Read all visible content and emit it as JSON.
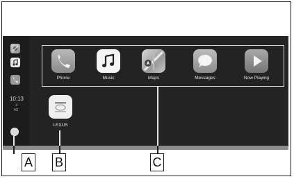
{
  "sidebar": {
    "time": "10:13",
    "signal": ".ıl",
    "network": "4G",
    "icons": [
      "maps-icon",
      "music-icon",
      "phone-icon"
    ]
  },
  "apps": [
    {
      "label": "Phone",
      "icon": "phone-icon"
    },
    {
      "label": "Music",
      "icon": "music-icon"
    },
    {
      "label": "Maps",
      "icon": "maps-icon"
    },
    {
      "label": "Messages",
      "icon": "messages-icon"
    },
    {
      "label": "Now Playing",
      "icon": "play-icon"
    }
  ],
  "lexus_app": {
    "label": "LEXUS",
    "icon": "lexus-icon"
  },
  "callouts": {
    "a": "A",
    "b": "B",
    "c": "C"
  }
}
